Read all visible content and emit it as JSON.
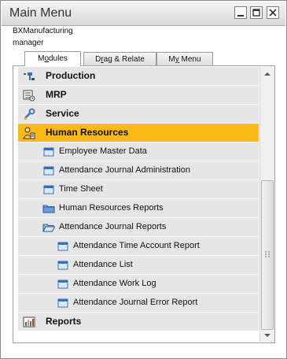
{
  "window": {
    "title": "Main Menu",
    "company": "BXManufacturing",
    "user": "manager"
  },
  "tabs": [
    {
      "label_pre": "M",
      "label_u": "o",
      "label_post": "dules",
      "active": true
    },
    {
      "label_pre": "D",
      "label_u": "r",
      "label_post": "ag & Relate",
      "active": false
    },
    {
      "label_pre": "M",
      "label_u": "y",
      "label_post": " Menu",
      "active": false
    }
  ],
  "menu": [
    {
      "label": "Production",
      "level": 0,
      "icon": "production-icon"
    },
    {
      "label": "MRP",
      "level": 0,
      "icon": "mrp-calendar-icon"
    },
    {
      "label": "Service",
      "level": 0,
      "icon": "service-wrench-icon"
    },
    {
      "label": "Human Resources",
      "level": 0,
      "icon": "human-resources-icon",
      "selected": true
    },
    {
      "label": "Employee Master Data",
      "level": 1,
      "icon": "form-icon"
    },
    {
      "label": "Attendance Journal Administration",
      "level": 1,
      "icon": "form-icon"
    },
    {
      "label": "Time Sheet",
      "level": 1,
      "icon": "form-icon"
    },
    {
      "label": "Human Resources Reports",
      "level": 1,
      "icon": "folder-closed-icon"
    },
    {
      "label": "Attendance Journal Reports",
      "level": 1,
      "icon": "folder-open-icon"
    },
    {
      "label": "Attendance Time Account Report",
      "level": 2,
      "icon": "form-icon"
    },
    {
      "label": "Attendance List",
      "level": 2,
      "icon": "form-icon"
    },
    {
      "label": "Attendance Work Log",
      "level": 2,
      "icon": "form-icon"
    },
    {
      "label": "Attendance Journal Error Report",
      "level": 2,
      "icon": "form-icon"
    },
    {
      "label": "Reports",
      "level": 0,
      "icon": "reports-chart-icon"
    }
  ],
  "colors": {
    "selected": "#fbb917",
    "row": "#e6e6e6"
  }
}
